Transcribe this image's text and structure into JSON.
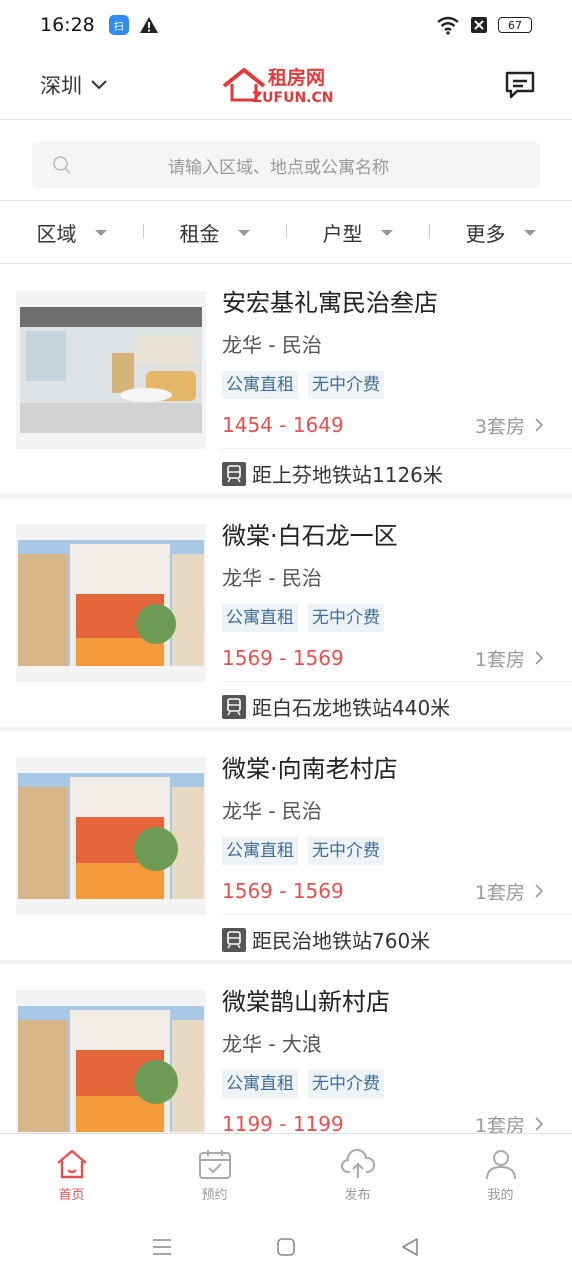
{
  "status_bar": {
    "time": "16:28",
    "app_badge": "扫",
    "battery": "67"
  },
  "header": {
    "city": "深圳",
    "logo_text": "租房网",
    "logo_sub": "ZUFUN.CN"
  },
  "search": {
    "placeholder": "请输入区域、地点或公寓名称"
  },
  "filters": [
    {
      "label": "区域"
    },
    {
      "label": "租金"
    },
    {
      "label": "户型"
    },
    {
      "label": "更多"
    }
  ],
  "listings": [
    {
      "title": "安宏基礼寓民治叁店",
      "area": "龙华 - 民治",
      "tags": [
        "公寓直租",
        "无中介费"
      ],
      "price": "1454 - 1649",
      "count": "3套房",
      "metro": "距上芬地铁站1126米"
    },
    {
      "title": "微棠·白石龙一区",
      "area": "龙华 - 民治",
      "tags": [
        "公寓直租",
        "无中介费"
      ],
      "price": "1569 - 1569",
      "count": "1套房",
      "metro": "距白石龙地铁站440米"
    },
    {
      "title": "微棠·向南老村店",
      "area": "龙华 - 民治",
      "tags": [
        "公寓直租",
        "无中介费"
      ],
      "price": "1569 - 1569",
      "count": "1套房",
      "metro": "距民治地铁站760米"
    },
    {
      "title": "微棠鹊山新村店",
      "area": "龙华 - 大浪",
      "tags": [
        "公寓直租",
        "无中介费"
      ],
      "price": "1199 - 1199",
      "count": "1套房",
      "metro": ""
    }
  ],
  "bottom_nav": [
    {
      "label": "首页",
      "icon": "home-icon",
      "active": true
    },
    {
      "label": "预约",
      "icon": "calendar-icon",
      "active": false
    },
    {
      "label": "发布",
      "icon": "cloud-upload-icon",
      "active": false
    },
    {
      "label": "我的",
      "icon": "user-icon",
      "active": false
    }
  ],
  "colors": {
    "accent": "#e85050",
    "tag_bg": "#eef3f8",
    "tag_text": "#3f6f99"
  }
}
